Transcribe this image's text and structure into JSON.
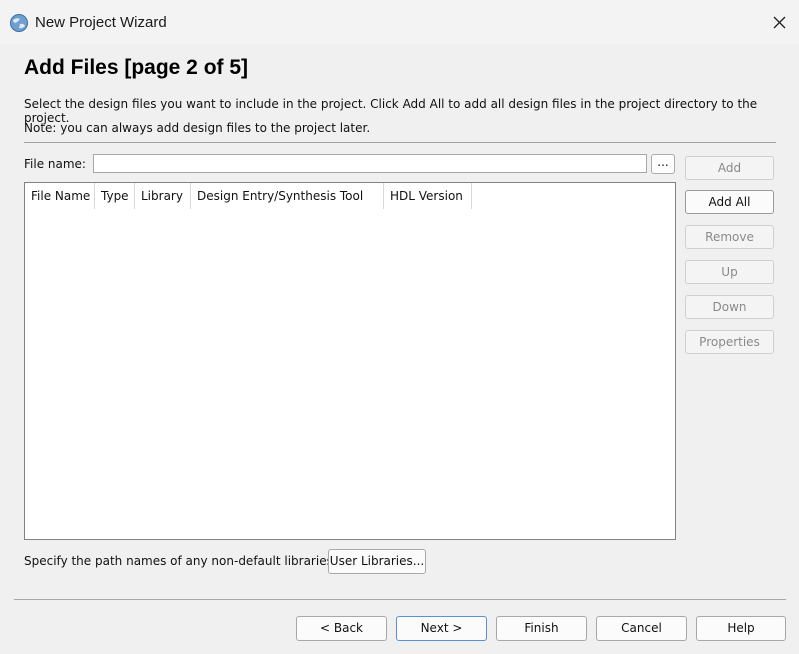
{
  "window": {
    "title": "New Project Wizard"
  },
  "page": {
    "heading": "Add Files [page 2 of 5]",
    "description": "Select the design files you want to include in the project. Click Add All to add all design files in the project directory to the project.",
    "note": "Note: you can always add design files to the project later."
  },
  "file_name": {
    "label": "File name:",
    "value": "",
    "browse_label": "..."
  },
  "table": {
    "columns": [
      "File Name",
      "Type",
      "Library",
      "Design Entry/Synthesis Tool",
      "HDL Version"
    ],
    "rows": []
  },
  "side_buttons": {
    "add": "Add",
    "add_all": "Add All",
    "remove": "Remove",
    "up": "Up",
    "down": "Down",
    "properties": "Properties"
  },
  "libraries": {
    "text": "Specify the path names of any non-default libraries.",
    "button": "User Libraries..."
  },
  "footer": {
    "back": "< Back",
    "next": "Next >",
    "finish": "Finish",
    "cancel": "Cancel",
    "help": "Help"
  }
}
